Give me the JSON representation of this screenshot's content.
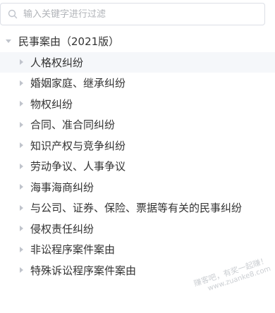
{
  "search": {
    "placeholder": "输入关键字进行过滤",
    "icon": "search-icon"
  },
  "tree": {
    "root": {
      "label": "民事案由（2021版）",
      "expanded": true
    },
    "children": [
      {
        "label": "人格权纠纷",
        "highlighted": true
      },
      {
        "label": "婚姻家庭、继承纠纷"
      },
      {
        "label": "物权纠纷"
      },
      {
        "label": "合同、准合同纠纷"
      },
      {
        "label": "知识产权与竞争纠纷"
      },
      {
        "label": "劳动争议、人事争议"
      },
      {
        "label": "海事海商纠纷"
      },
      {
        "label": "与公司、证券、保险、票据等有关的民事纠纷"
      },
      {
        "label": "侵权责任纠纷"
      },
      {
        "label": "非讼程序案件案由"
      },
      {
        "label": "特殊诉讼程序案件案由"
      }
    ]
  },
  "watermark": {
    "text": "赚客吧，有奖一起赚！",
    "url": "www.zuanke8.com"
  }
}
